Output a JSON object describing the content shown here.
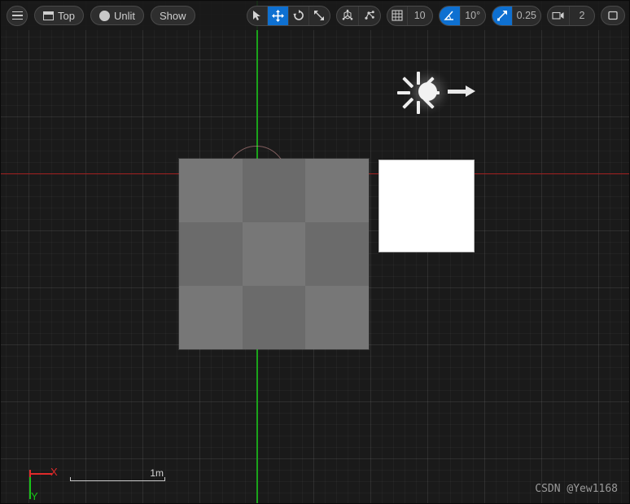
{
  "viewport": {
    "title": "3D Viewport",
    "background_color": "#262626",
    "grid_color": "#3a3a3a",
    "axis_x_color": "#a32020",
    "axis_y_color": "#1aa31a",
    "accent_color": "#0e70d1"
  },
  "toolbar": {
    "menu_icon": "hamburger-icon",
    "view_mode": {
      "label": "Top",
      "icon": "viewport-window-icon"
    },
    "lighting_mode": {
      "label": "Unlit",
      "icon": "sphere-icon"
    },
    "show": {
      "label": "Show"
    },
    "transform_tools": [
      {
        "name": "select",
        "icon": "cursor-arrow-icon",
        "active": false
      },
      {
        "name": "move",
        "icon": "move-arrows-icon",
        "active": true
      },
      {
        "name": "rotate",
        "icon": "rotate-icon",
        "active": false
      },
      {
        "name": "scale",
        "icon": "scale-icon",
        "active": false
      }
    ],
    "coordinate_tools": [
      {
        "name": "coordinate-system",
        "icon": "world-axis-icon",
        "active": false
      },
      {
        "name": "pivot-mode",
        "icon": "pivot-points-icon",
        "active": false
      }
    ],
    "grid_snap": {
      "icon": "grid-icon",
      "value": "10",
      "active": false
    },
    "angle_snap": {
      "icon": "angle-icon",
      "value": "10°",
      "active": true
    },
    "scale_snap": {
      "icon": "scale-snap-arrow-icon",
      "value": "0.25",
      "active": true
    },
    "camera_speed": {
      "icon": "camera-icon",
      "value": "2",
      "active": false
    },
    "maximize": {
      "icon": "maximize-viewport-icon",
      "active": false
    }
  },
  "scene": {
    "objects": [
      {
        "name": "checkered-plane",
        "type": "static-mesh",
        "material": "checker-gray"
      },
      {
        "name": "white-plane",
        "type": "static-mesh",
        "material": "white"
      },
      {
        "name": "directional-light",
        "type": "light",
        "icon": "sun-light-gizmo"
      }
    ],
    "checker_colors": [
      "#777777",
      "#6b6b6b"
    ],
    "white_plane_color": "#ffffff"
  },
  "overlay": {
    "axis_x_label": "X",
    "axis_y_label": "Y",
    "scale_label": "1m",
    "watermark": "CSDN @Yew1168"
  }
}
